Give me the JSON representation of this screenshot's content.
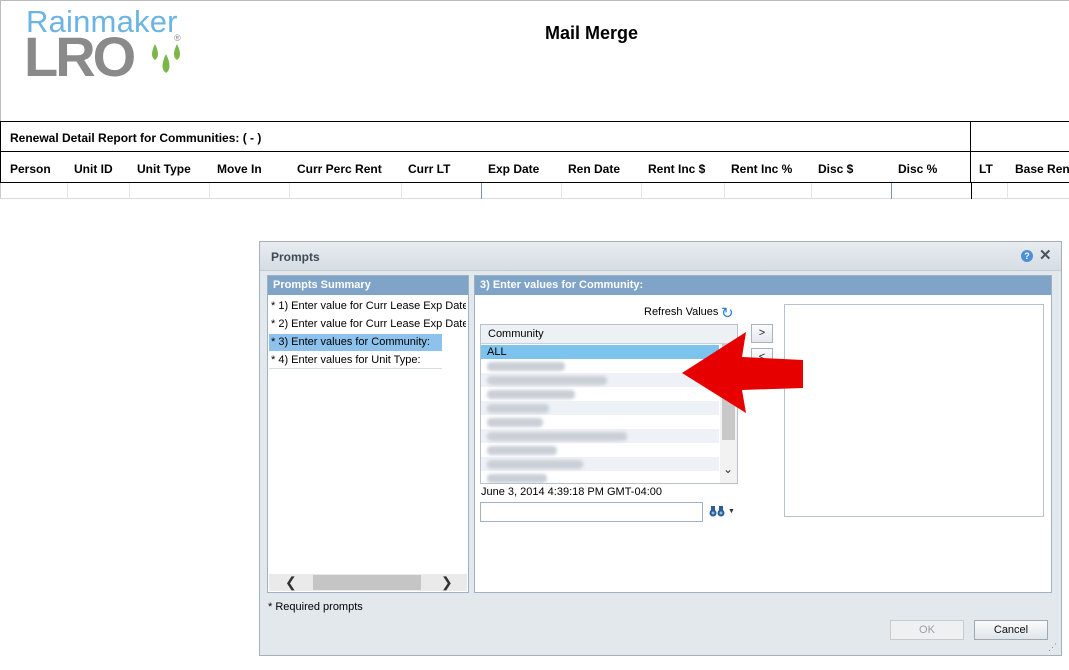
{
  "header": {
    "logo_top": "Rainmaker",
    "logo_main": "LRO",
    "logo_reg": "®",
    "title": "Mail Merge"
  },
  "report": {
    "caption": "Renewal Detail Report for Communities:   ( - )",
    "columns": [
      "Person",
      "Unit ID",
      "Unit Type",
      "Move In",
      "Curr Perc Rent",
      "Curr LT",
      "Exp Date",
      "Ren Date",
      "Rent Inc $",
      "Rent Inc %",
      "Disc $",
      "Disc %",
      "LT",
      "Base Ren"
    ]
  },
  "dialog": {
    "title": "Prompts",
    "help_icon": "?",
    "close_icon": "✕",
    "summary": {
      "header": "Prompts Summary",
      "items": [
        "* 1) Enter value for Curr Lease Exp Date",
        "* 2) Enter value for Curr Lease Exp Date",
        "* 3) Enter values for Community:",
        "* 4) Enter values for Unit Type:"
      ],
      "selected_index": 2,
      "scroll_left": "❮",
      "scroll_right": "❯"
    },
    "values": {
      "header": "3) Enter values for Community:",
      "refresh_label": "Refresh Values",
      "list_header": "Community",
      "list_items": [
        "ALL"
      ],
      "add_button": ">",
      "remove_button": "<",
      "scroll_down": "⌄",
      "timestamp": "June 3, 2014 4:39:18 PM GMT-04:00",
      "search_value": "",
      "dropdown_arrow": "▼"
    },
    "required_note": "* Required prompts",
    "ok_label": "OK",
    "cancel_label": "Cancel"
  },
  "colors": {
    "accent_blue": "#7fa4c7",
    "selection": "#7cc3ee",
    "logo_blue": "#6cb4e4",
    "logo_gray": "#8a8a8a",
    "logo_green": "#7ab648",
    "annotation_red": "#e60000"
  },
  "icons": {
    "help": "help-icon",
    "close": "close-icon",
    "refresh": "refresh-icon",
    "search": "binoculars-icon",
    "arrow": "red-arrow-annotation"
  }
}
